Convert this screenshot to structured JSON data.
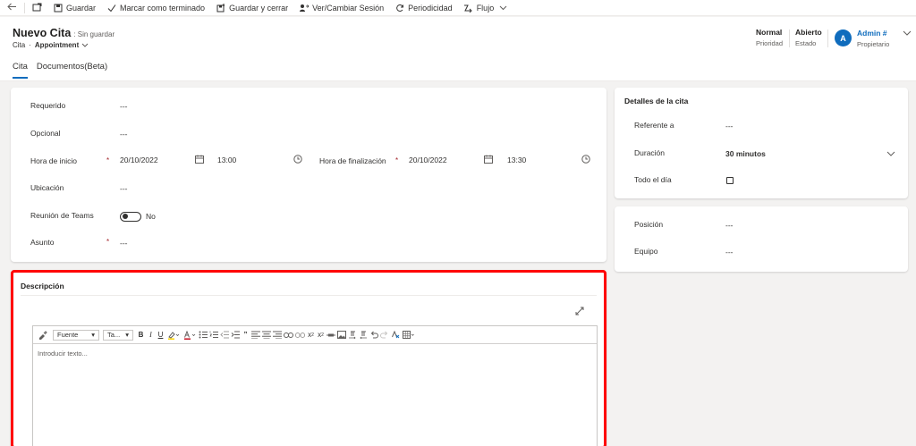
{
  "commandbar": {
    "save": "Guardar",
    "mark_complete": "Marcar como terminado",
    "save_close": "Guardar y cerrar",
    "session": "Ver/Cambiar Sesión",
    "recurrence": "Periodicidad",
    "flow": "Flujo"
  },
  "header": {
    "title": "Nuevo Cita",
    "unsaved": ": Sin guardar",
    "entity": "Cita",
    "form": "Appointment",
    "priority_value": "Normal",
    "priority_label": "Prioridad",
    "state_value": "Abierto",
    "state_label": "Estado",
    "avatar_initial": "A",
    "owner_value": "Admin #",
    "owner_label": "Propietario"
  },
  "tabs": [
    {
      "label": "Cita"
    },
    {
      "label": "Documentos(Beta)"
    }
  ],
  "main": {
    "required_label": "Requerido",
    "required_value": "---",
    "optional_label": "Opcional",
    "optional_value": "---",
    "start_label": "Hora de inicio",
    "start_date": "20/10/2022",
    "start_time": "13:00",
    "end_label": "Hora de finalización",
    "end_date": "20/10/2022",
    "end_time": "13:30",
    "location_label": "Ubicación",
    "location_value": "---",
    "teams_label": "Reunión de Teams",
    "teams_value": "No",
    "subject_label": "Asunto",
    "subject_value": "---",
    "required_marker": "*"
  },
  "details": {
    "title": "Detalles de la cita",
    "regarding_label": "Referente a",
    "regarding_value": "---",
    "duration_label": "Duración",
    "duration_value": "30 minutos",
    "allday_label": "Todo el día"
  },
  "position": {
    "position_label": "Posición",
    "position_value": "---",
    "team_label": "Equipo",
    "team_value": "---"
  },
  "description": {
    "title": "Descripción",
    "font_select": "Fuente",
    "size_select": "Ta...",
    "placeholder": "Introducir texto..."
  },
  "colors": {
    "accent": "#0f6cbd",
    "highlight_border": "#ff0000",
    "required": "#a4262c"
  }
}
